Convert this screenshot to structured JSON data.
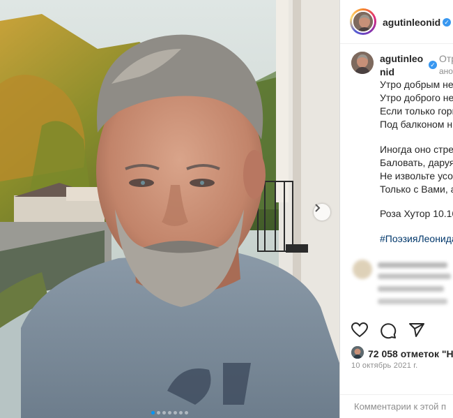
{
  "post": {
    "username": "agutinleonid",
    "verified": true,
    "caption_author_line1": "agutinleo",
    "caption_author_line2": "nid",
    "follow_hint": "Отр",
    "follow_hint2": "ано",
    "caption_lines": [
      "Утро добрым не",
      "Утро доброго не",
      "Если только горн",
      "Под балконом н",
      "",
      "Иногда оно стре",
      "Баловать, даруя",
      "Не извольте усо",
      "Только с Вами, а",
      "",
      "Роза Хутор 10.10"
    ],
    "hashtag": "#ПоэзияЛеонида",
    "likes": "72 058 отметок \"Н",
    "date": "10 октябрь 2021 г.",
    "comment_placeholder": "Комментарии к этой п"
  },
  "carousel": {
    "current": 1,
    "total": 7
  },
  "colors": {
    "accent": "#0095f6",
    "verified": "#3897f0",
    "hashtag": "#00376b",
    "muted": "#8e8e8e"
  },
  "icons": [
    "chevron-right-icon",
    "heart-icon",
    "comment-icon",
    "share-icon",
    "verified-icon"
  ]
}
